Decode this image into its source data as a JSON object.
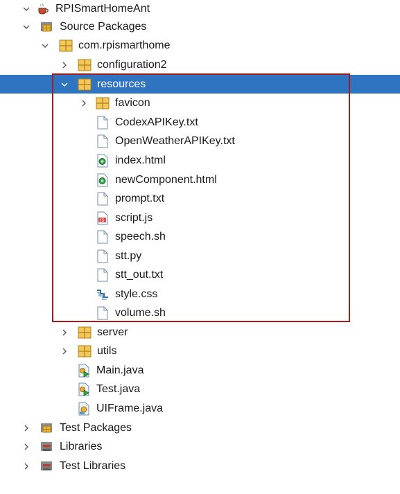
{
  "project": {
    "name": "RPISmartHomeAnt",
    "nodes": {
      "source_packages": "Source Packages",
      "package": "com.rpismarthome",
      "configuration2": "configuration2",
      "resources": "resources",
      "favicon": "favicon",
      "codex_key": "CodexAPIKey.txt",
      "openweather_key": "OpenWeatherAPIKey.txt",
      "index_html": "index.html",
      "new_component_html": "newComponent.html",
      "prompt_txt": "prompt.txt",
      "script_js": "script.js",
      "speech_sh": "speech.sh",
      "stt_py": "stt.py",
      "stt_out_txt": "stt_out.txt",
      "style_css": "style.css",
      "volume_sh": "volume.sh",
      "server": "server",
      "utils": "utils",
      "main_java": "Main.java",
      "test_java": "Test.java",
      "uiframe_java": "UIFrame.java",
      "test_packages": "Test Packages",
      "libraries": "Libraries",
      "test_libraries": "Test Libraries"
    }
  },
  "colors": {
    "selection": "#2f74c0",
    "highlight_border": "#a31b1b",
    "package_icon": "#e8b43c"
  },
  "selected_node": "resources"
}
